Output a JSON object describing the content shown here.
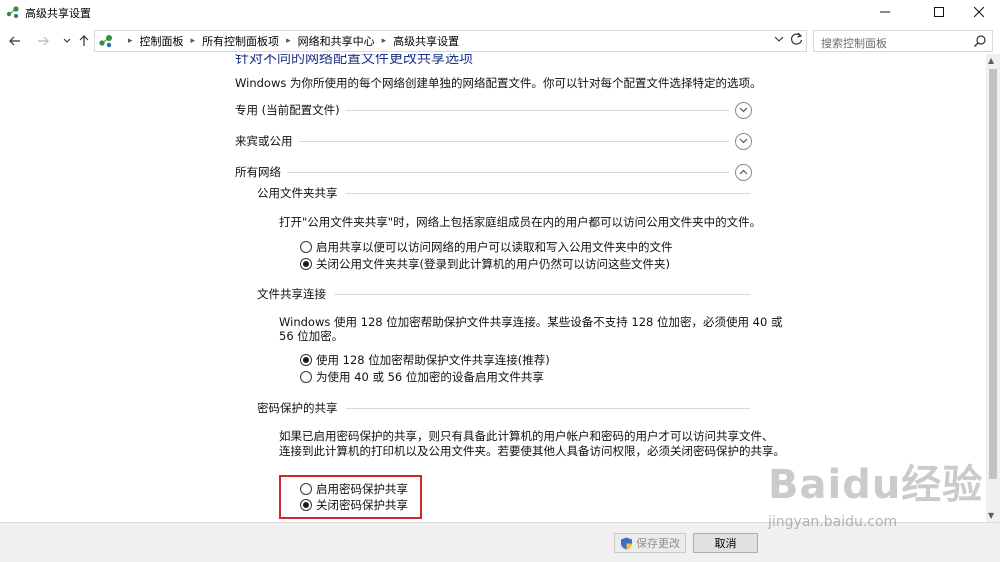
{
  "window": {
    "title": "高级共享设置",
    "minimize_icon": "minimize-icon",
    "maximize_icon": "maximize-icon",
    "close_icon": "close-icon"
  },
  "nav": {
    "breadcrumbs": [
      "控制面板",
      "所有控制面板项",
      "网络和共享中心",
      "高级共享设置"
    ],
    "search_placeholder": "搜索控制面板"
  },
  "content": {
    "heading": "针对不同的网络配置文件更改共享选项",
    "intro": "Windows 为你所使用的每个网络创建单独的网络配置文件。你可以针对每个配置文件选择特定的选项。",
    "sections": {
      "private": "专用 (当前配置文件)",
      "guest": "来宾或公用",
      "all": "所有网络"
    },
    "public_folder": {
      "title": "公用文件夹共享",
      "desc": "打开\"公用文件夹共享\"时，网络上包括家庭组成员在内的用户都可以访问公用文件夹中的文件。",
      "options": [
        {
          "label": "启用共享以便可以访问网络的用户可以读取和写入公用文件夹中的文件",
          "checked": false
        },
        {
          "label": "关闭公用文件夹共享(登录到此计算机的用户仍然可以访问这些文件夹)",
          "checked": true
        }
      ]
    },
    "file_sharing": {
      "title": "文件共享连接",
      "desc_line1": "Windows 使用 128 位加密帮助保护文件共享连接。某些设备不支持 128 位加密，必须使用 40 或",
      "desc_line2": "56 位加密。",
      "options": [
        {
          "label": "使用 128 位加密帮助保护文件共享连接(推荐)",
          "checked": true
        },
        {
          "label": "为使用 40 或 56 位加密的设备启用文件共享",
          "checked": false
        }
      ]
    },
    "password": {
      "title": "密码保护的共享",
      "desc_line1": "如果已启用密码保护的共享，则只有具备此计算机的用户帐户和密码的用户才可以访问共享文件、",
      "desc_line2": "连接到此计算机的打印机以及公用文件夹。若要使其他人具备访问权限，必须关闭密码保护的共享。",
      "options": [
        {
          "label": "启用密码保护共享",
          "checked": false
        },
        {
          "label": "关闭密码保护共享",
          "checked": true
        }
      ],
      "highlight_color": "#d8262b"
    }
  },
  "footer": {
    "save_label": "保存更改",
    "cancel_label": "取消"
  },
  "watermark": {
    "logo": "Baidu经验",
    "url": "jingyan.baidu.com"
  }
}
